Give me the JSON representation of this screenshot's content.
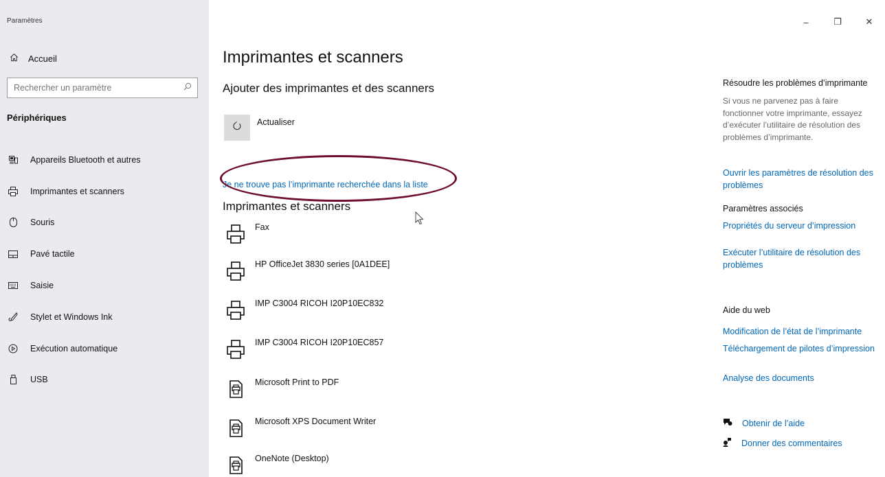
{
  "window": {
    "app_title": "Paramètres",
    "minimize": "–",
    "restore": "❐",
    "close": "✕"
  },
  "sidebar": {
    "home_label": "Accueil",
    "search_placeholder": "Rechercher un paramètre",
    "section_title": "Périphériques",
    "items": [
      {
        "label": "Appareils Bluetooth et autres",
        "icon": "bluetooth-devices-icon"
      },
      {
        "label": "Imprimantes et scanners",
        "icon": "printer-icon"
      },
      {
        "label": "Souris",
        "icon": "mouse-icon"
      },
      {
        "label": "Pavé tactile",
        "icon": "touchpad-icon"
      },
      {
        "label": "Saisie",
        "icon": "keyboard-icon"
      },
      {
        "label": "Stylet et Windows Ink",
        "icon": "pen-icon"
      },
      {
        "label": "Exécution automatique",
        "icon": "autoplay-icon"
      },
      {
        "label": "USB",
        "icon": "usb-icon"
      }
    ]
  },
  "main": {
    "title": "Imprimantes et scanners",
    "add_title": "Ajouter des imprimantes et des scanners",
    "refresh_label": "Actualiser",
    "not_listed_link": "Je ne trouve pas l’imprimante recherchée dans la liste",
    "list_title": "Imprimantes et scanners",
    "printers": [
      {
        "name": "Fax",
        "icon": "printer-icon"
      },
      {
        "name": "HP OfficeJet 3830 series [0A1DEE]",
        "icon": "printer-icon"
      },
      {
        "name": "IMP C3004 RICOH I20P10EC832",
        "icon": "printer-icon"
      },
      {
        "name": "IMP C3004 RICOH I20P10EC857",
        "icon": "printer-icon"
      },
      {
        "name": "Microsoft Print to PDF",
        "icon": "virtual-printer-icon"
      },
      {
        "name": "Microsoft XPS Document Writer",
        "icon": "virtual-printer-icon"
      },
      {
        "name": "OneNote (Desktop)",
        "icon": "virtual-printer-icon"
      }
    ]
  },
  "right_panel": {
    "troubleshoot_title": "Résoudre les problèmes d’imprimante",
    "troubleshoot_text": "Si vous ne parvenez pas à faire fonctionner votre imprimante, essayez d’exécuter l’utilitaire de résolution des problèmes d’imprimante.",
    "troubleshoot_link": "Ouvrir les paramètres de résolution des problèmes",
    "related_title": "Paramètres associés",
    "related_links": [
      "Propriétés du serveur d’impression",
      "Exécuter l’utilitaire de résolution des problèmes"
    ],
    "web_help_title": "Aide du web",
    "web_help_links": [
      "Modification de l’état de l’imprimante",
      "Téléchargement de pilotes d’impression",
      "Analyse des documents"
    ],
    "get_help": "Obtenir de l’aide",
    "feedback": "Donner des commentaires"
  },
  "colors": {
    "link": "#0067b8",
    "sidebar_bg": "#ebebef",
    "annotation_ellipse": "#6e0f2c"
  }
}
